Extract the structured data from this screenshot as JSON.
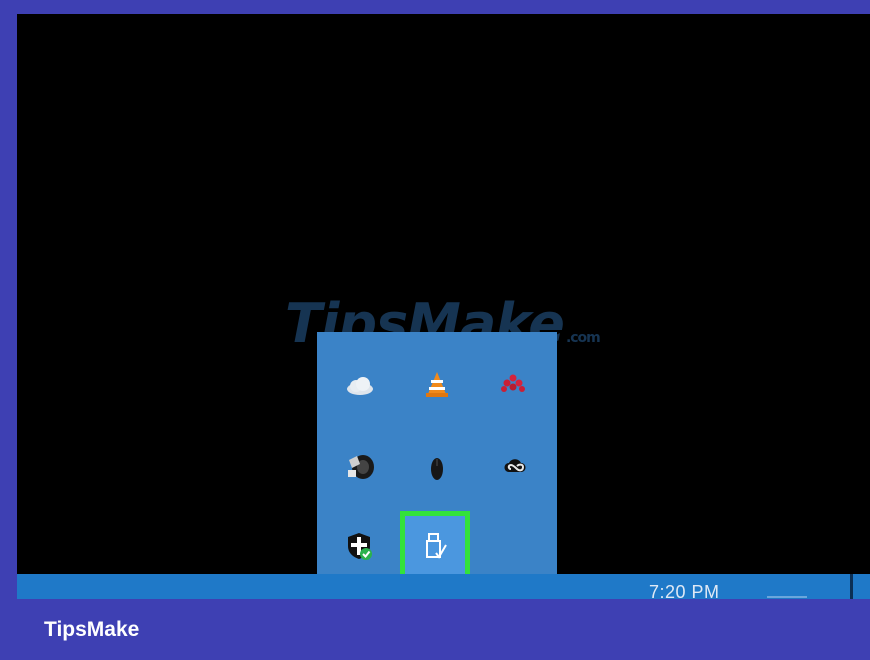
{
  "taskbar": {
    "clock": "7:20 PM"
  },
  "watermark": {
    "brand": "TipsMake",
    "suffix": ".com"
  },
  "footer": {
    "brand": "TipsMake"
  },
  "tray": {
    "icons": [
      {
        "name": "onedrive-cloud-icon"
      },
      {
        "name": "vlc-cone-icon"
      },
      {
        "name": "dots-app-icon"
      },
      {
        "name": "speaker-audio-icon"
      },
      {
        "name": "mouse-icon"
      },
      {
        "name": "creative-cloud-icon"
      },
      {
        "name": "windows-security-icon"
      },
      {
        "name": "safely-remove-hardware-icon"
      }
    ]
  },
  "colors": {
    "highlight_border": "#33e23a",
    "tray_background": "#3b83c7",
    "taskbar": "#1f79c8",
    "frame": "#3e40b3"
  }
}
